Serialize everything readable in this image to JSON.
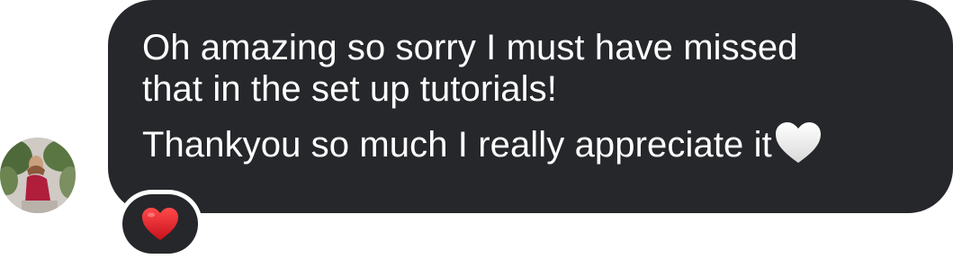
{
  "message": {
    "lines": [
      "Oh amazing so sorry I must have missed",
      "that in the set up tutorials!",
      "Thankyou so much I really appreciate it"
    ],
    "trailing_emoji": "white-heart-icon"
  },
  "avatar": {
    "icon": "user-avatar-photo"
  },
  "reaction": {
    "icon": "red-heart-icon"
  },
  "colors": {
    "bubble": "#26272b",
    "text": "#ffffff",
    "heart_red": "#e0202a"
  }
}
